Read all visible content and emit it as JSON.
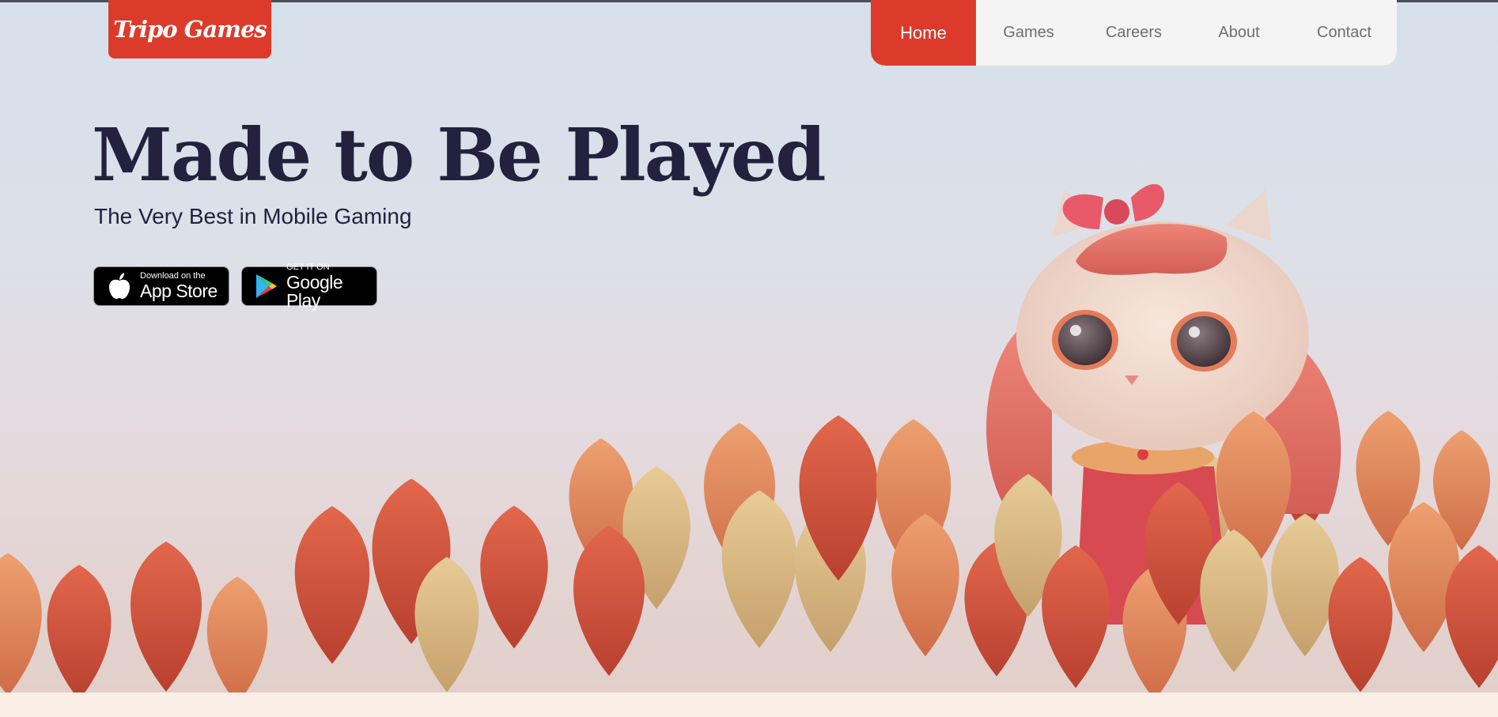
{
  "brand": {
    "logo_text": "Tripo Games",
    "accent": "#dc3b2b"
  },
  "nav": {
    "items": [
      {
        "label": "Home",
        "active": true
      },
      {
        "label": "Games",
        "active": false
      },
      {
        "label": "Careers",
        "active": false
      },
      {
        "label": "About",
        "active": false
      },
      {
        "label": "Contact",
        "active": false
      }
    ]
  },
  "hero": {
    "title": "Made to Be Played",
    "subtitle": "The Very Best in Mobile Gaming",
    "title_color": "#22223f"
  },
  "stores": {
    "apple": {
      "small": "Download on the",
      "big": "App Store",
      "icon": "apple-icon"
    },
    "google": {
      "small": "GET IT ON",
      "big": "Google Play",
      "icon": "google-play-icon"
    }
  }
}
